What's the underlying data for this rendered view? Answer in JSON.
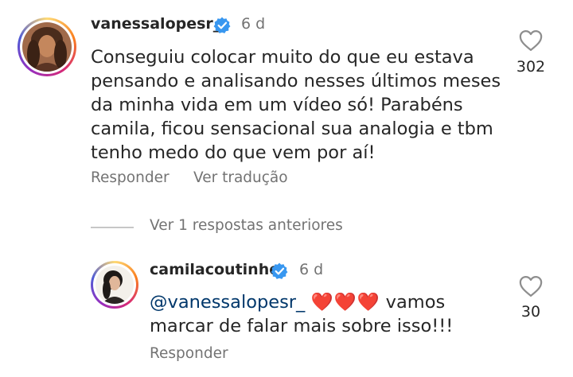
{
  "comment": {
    "username": "vanessalopesr_",
    "time": "6 d",
    "text": "Conseguiu colocar muito do que eu estava pensando e analisando nesses últimos meses da minha vida em um vídeo só! Parabéns camila, ficou sensacional sua analogia e tbm tenho medo do que vem por aí!",
    "likes": "302",
    "reply_label": "Responder",
    "translate_label": "Ver tradução"
  },
  "view_replies_label": "Ver 1 respostas anteriores",
  "reply": {
    "username": "camilacoutinho",
    "time": "6 d",
    "mention": "@vanessalopesr_",
    "hearts": "❤️❤️❤️",
    "text": "vamos marcar de falar mais sobre isso!!!",
    "likes": "30",
    "reply_label": "Responder"
  },
  "colors": {
    "verified": "#3897f0",
    "mention": "#00376b",
    "secondary_text": "#737373"
  },
  "icons": [
    "verified-badge-icon",
    "heart-outline-icon"
  ]
}
